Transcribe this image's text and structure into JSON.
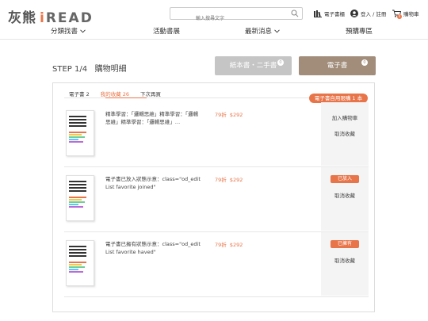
{
  "header": {
    "logo_cn": "灰熊",
    "logo_en_i": "i",
    "logo_en_rest": "READ",
    "search_placeholder": "輸入搜尋文字",
    "ebook_shelf": "電子書櫃",
    "login": "登入 / 註冊",
    "cart": "購物車",
    "cart_count": "0"
  },
  "nav": {
    "items": [
      {
        "label": "分類找書",
        "dropdown": true
      },
      {
        "label": "活動書展",
        "dropdown": false
      },
      {
        "label": "最新消息",
        "dropdown": true
      },
      {
        "label": "預購專區",
        "dropdown": false
      }
    ]
  },
  "main": {
    "step_title": "STEP 1/4   購物明細",
    "tabs": [
      {
        "label": "紙本書・二手書",
        "count": "0"
      },
      {
        "label": "電子書",
        "count": "0"
      }
    ],
    "subtabs": [
      {
        "label": "電子書 2"
      },
      {
        "label": "我的收藏 26"
      },
      {
        "label": "下次再買"
      }
    ],
    "quota_pill": "電子書自用限購 1 本",
    "items": [
      {
        "desc": "精準學習：「邏輯思維」精準學習：「邏輯思維」精準學習：「邏輯思維」…",
        "discount": "79折",
        "price": "$292",
        "primary_action": "加入購物車",
        "secondary_action": "取消收藏",
        "status": ""
      },
      {
        "desc": "電子書已放入狀態示意：class=\"od_editList favorite joined\"",
        "discount": "79折",
        "price": "$292",
        "primary_action": "",
        "secondary_action": "取消收藏",
        "status": "已放入"
      },
      {
        "desc": "電子書已擁有狀態示意：class=\"od_editList favorite haved\"",
        "discount": "79折",
        "price": "$292",
        "primary_action": "",
        "secondary_action": "取消收藏",
        "status": "已擁有"
      }
    ]
  },
  "colors": {
    "accent": "#e8754a",
    "tab_inactive": "#c5c5c5",
    "tab_active": "#a18d7a"
  }
}
